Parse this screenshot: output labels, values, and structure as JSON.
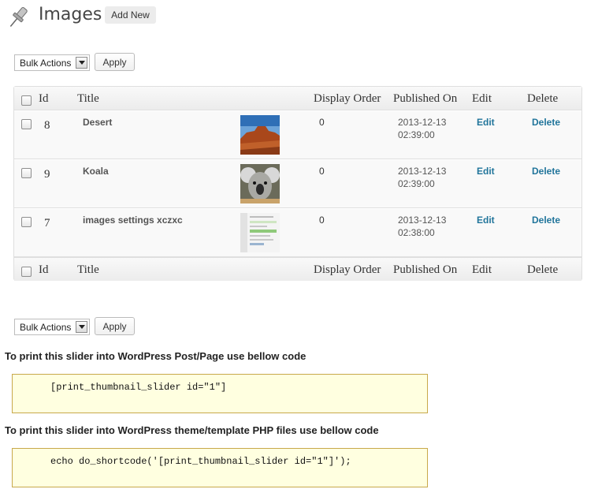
{
  "header": {
    "title": "Images",
    "add_new_label": "Add New"
  },
  "bulk_top": {
    "select_value": "Bulk Actions",
    "apply_label": "Apply"
  },
  "bulk_bottom": {
    "select_value": "Bulk Actions",
    "apply_label": "Apply"
  },
  "table": {
    "columns": {
      "id": "Id",
      "title": "Title",
      "display_order": "Display Order",
      "published_on": "Published On",
      "edit": "Edit",
      "delete": "Delete"
    },
    "rows": [
      {
        "id": "8",
        "title": "Desert",
        "thumb": "desert-thumbnail",
        "order": "0",
        "date": "2013-12-13",
        "time": "02:39:00",
        "edit": "Edit",
        "delete": "Delete"
      },
      {
        "id": "9",
        "title": "Koala",
        "thumb": "koala-thumbnail",
        "order": "0",
        "date": "2013-12-13",
        "time": "02:39:00",
        "edit": "Edit",
        "delete": "Delete"
      },
      {
        "id": "7",
        "title": "images settings xczxc",
        "thumb": "screenshot-thumbnail",
        "order": "0",
        "date": "2013-12-13",
        "time": "02:38:00",
        "edit": "Edit",
        "delete": "Delete"
      }
    ]
  },
  "shortcode": {
    "post_heading": "To print this slider into WordPress Post/Page use bellow code",
    "post_code": "[print_thumbnail_slider id=\"1\"]",
    "theme_heading": "To print this slider into WordPress theme/template PHP files use bellow code",
    "theme_code": "echo do_shortcode('[print_thumbnail_slider id=\"1\"]');"
  },
  "icons": {
    "header": "pushpin-icon",
    "select_arrow": "dropdown-arrow-icon"
  },
  "colors": {
    "link": "#21759b",
    "code_background": "#ffffe0",
    "code_border": "#c8a94b"
  }
}
